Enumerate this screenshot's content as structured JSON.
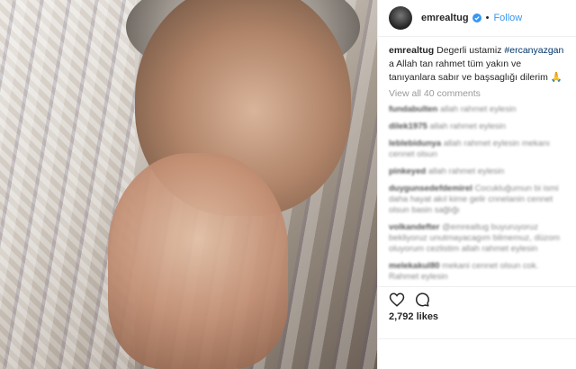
{
  "post": {
    "username": "emrealtug",
    "follow_label": "Follow",
    "caption_user": "emrealtug",
    "caption_pre": " Degerli ustamiz ",
    "caption_tag": "#ercanyazgan",
    "caption_post": " a Allah tan rahmet tüm yakın ve tanıyanlara sabır ve başsaglığı dilerim 🙏",
    "view_all": "View all 40 comments",
    "likes": "2,792 likes",
    "comments": [
      {
        "user": "fundabulten",
        "text": "allah rahmet eylesin"
      },
      {
        "user": "dilek1975",
        "text": "allah rahmet eylesin"
      },
      {
        "user": "leblebidunya",
        "text": "allah rahmet eylesin mekanı cennet olsun"
      },
      {
        "user": "pinkeyed",
        "text": "allah rahmet eylesin"
      },
      {
        "user": "duygunsedefdemirel",
        "text": "Cocukluğumun bi ismi daha hayat akıl kime gelir cnnelanin cennet olsun basin sağlığı"
      },
      {
        "user": "volkandefter",
        "text": "@emrealtug buyuruyoruz bekliyoruz unutmayacagım bilmemuz, düzom oluyorum cezlistim allah rahmet eylesin"
      },
      {
        "user": "melekakul80",
        "text": "mekani cennet olsun cok. Rahmet eylesin"
      }
    ],
    "colors": {
      "follow": "#3897f0",
      "hashtag": "#003569",
      "verified": "#3897f0"
    }
  }
}
